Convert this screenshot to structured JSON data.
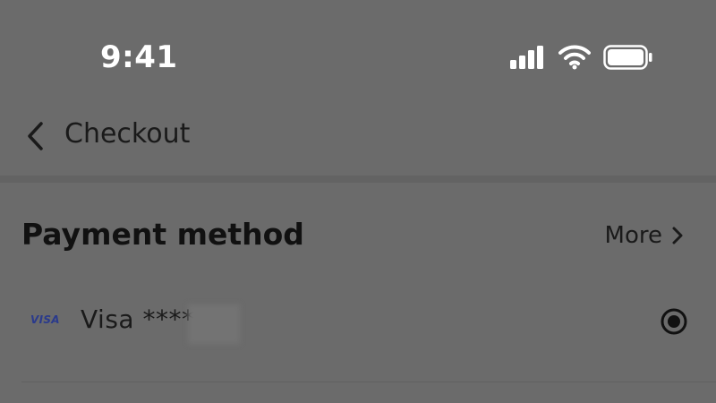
{
  "status_bar": {
    "time": "9:41",
    "icons": [
      "signal-icon",
      "wifi-icon",
      "battery-icon"
    ]
  },
  "nav": {
    "title": "Checkout",
    "back_icon": "chevron-left-icon"
  },
  "payment": {
    "section_title": "Payment method",
    "more_label": "More",
    "more_icon": "chevron-right-icon",
    "selected_method": {
      "brand": "VISA",
      "label": "Visa ****",
      "selected": true
    }
  },
  "colors": {
    "background": "#6b6b6b",
    "text_primary": "#1a1a1a",
    "status_text": "#ffffff",
    "visa_blue": "#2a3a8c"
  }
}
